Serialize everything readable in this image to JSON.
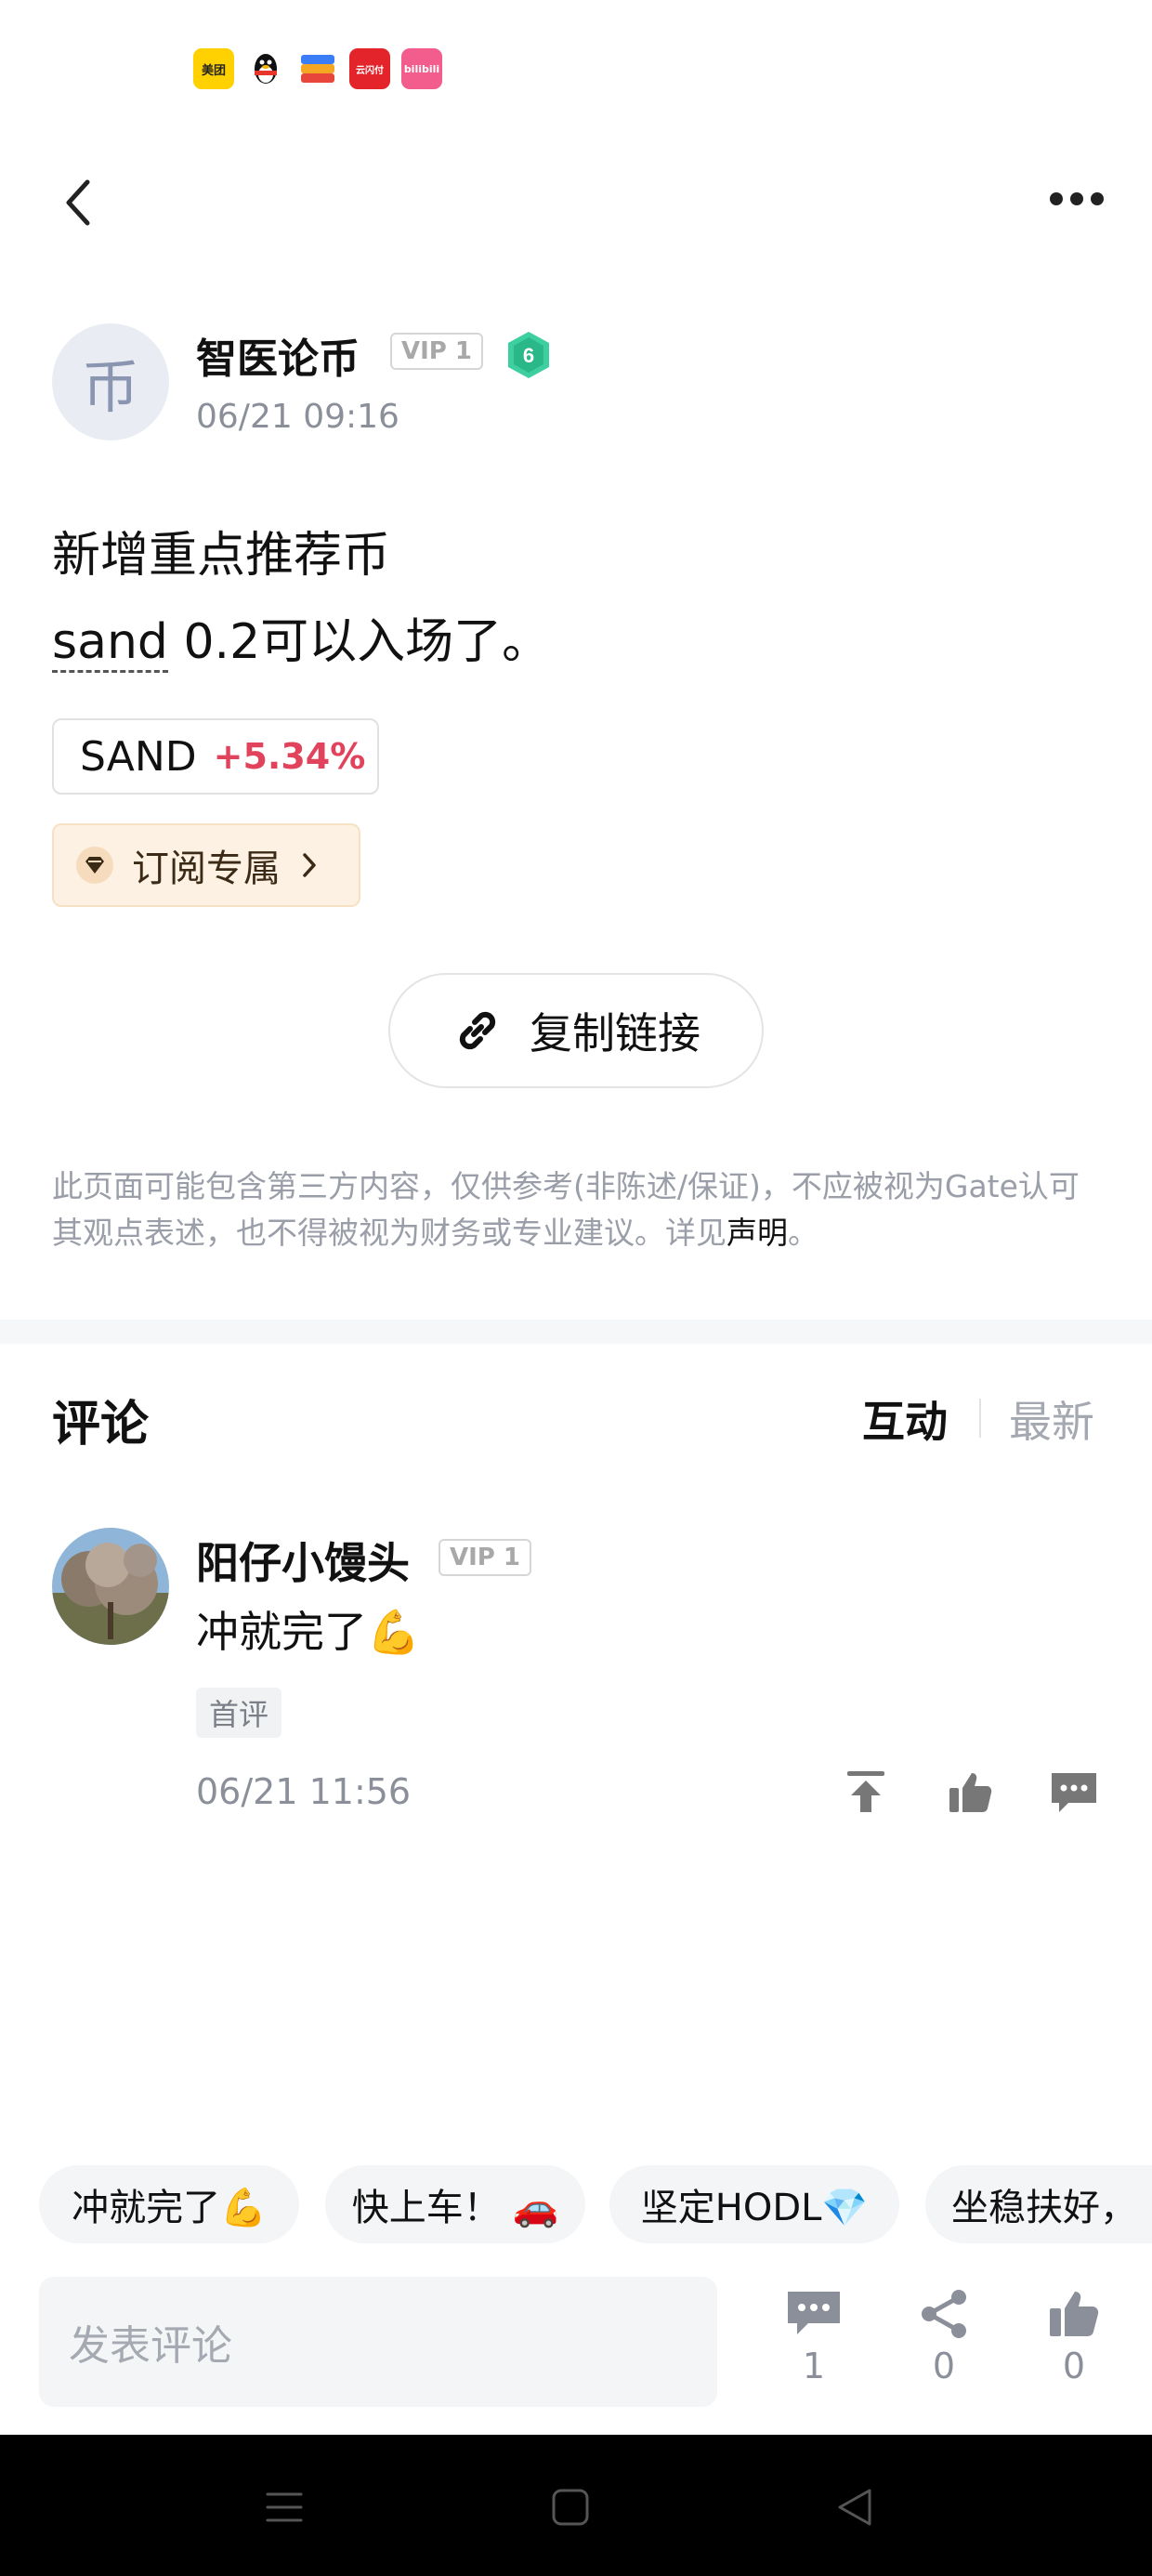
{
  "status_bar": {
    "app_icons": [
      "美团",
      "QQ",
      "wallet-app",
      "云闪付",
      "bilibili"
    ]
  },
  "header": {
    "back_icon": "chevron-left-icon",
    "more_icon": "more-horizontal-icon"
  },
  "post": {
    "author": {
      "avatar_char": "币",
      "name": "智医论币",
      "vip": "VIP 1",
      "level": "6"
    },
    "time": "06/21 09:16",
    "line1": "新增重点推荐币",
    "token": "sand",
    "line2_rest": " 0.2可以入场了。",
    "coin_tag": {
      "symbol": "SAND",
      "change": "+5.34%",
      "change_color": "#e0435b"
    },
    "subscription": {
      "label": "订阅专属"
    },
    "copy_link": {
      "label": "复制链接"
    },
    "disclaimer_text": "此页面可能包含第三方内容，仅供参考(非陈述/保证)，不应被视为Gate认可其观点表述，也不得被视为财务或专业建议。详见",
    "disclaimer_link": "声明",
    "disclaimer_end": "。"
  },
  "comments": {
    "title": "评论",
    "tabs": {
      "hot": "互动",
      "new": "最新"
    },
    "items": [
      {
        "name": "阳仔小馒头",
        "vip": "VIP 1",
        "text": "冲就完了💪",
        "tag": "首评",
        "time": "06/21 11:56"
      }
    ]
  },
  "quick_replies": [
    "冲就完了💪",
    "快上车！ 🚗",
    "坚定HODL💎",
    "坐稳扶好，"
  ],
  "bottom_bar": {
    "input_placeholder": "发表评论",
    "comment_count": "1",
    "share_count": "0",
    "like_count": "0"
  },
  "colors": {
    "accent_red": "#e0435b",
    "level_badge": "#3dcfa0"
  }
}
